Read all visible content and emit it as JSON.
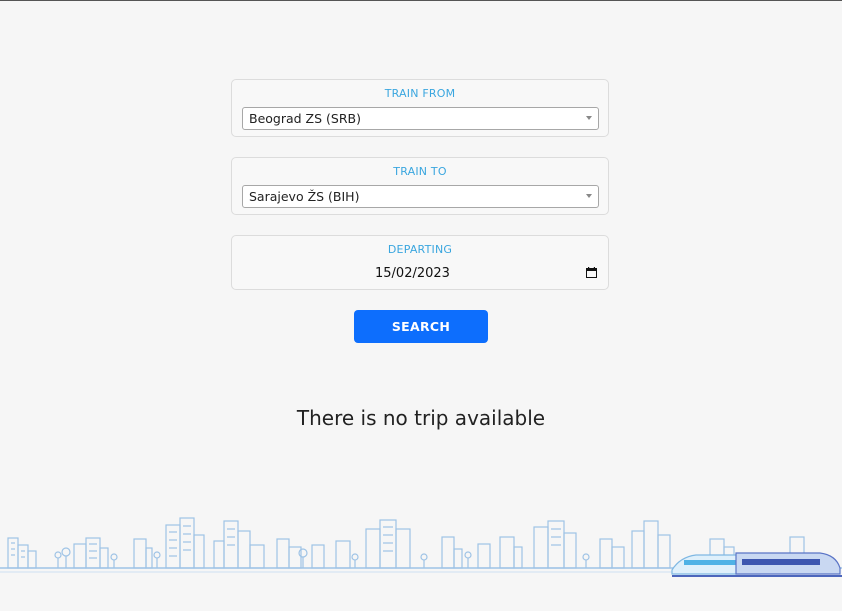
{
  "form": {
    "from": {
      "label": "TRAIN FROM",
      "value": "Beograd ZS (SRB)"
    },
    "to": {
      "label": "TRAIN TO",
      "value": "Sarajevo ŽS (BIH)"
    },
    "departing": {
      "label": "DEPARTING",
      "value": "15/02/2023"
    },
    "search_label": "SEARCH"
  },
  "results": {
    "message": "There is no trip available"
  },
  "colors": {
    "accent_label": "#3aa6df",
    "button": "#0d6efd",
    "skyline": "#9ec3e6"
  },
  "icons": {
    "calendar": "calendar-icon",
    "select_arrow": "chevron-down-icon"
  }
}
